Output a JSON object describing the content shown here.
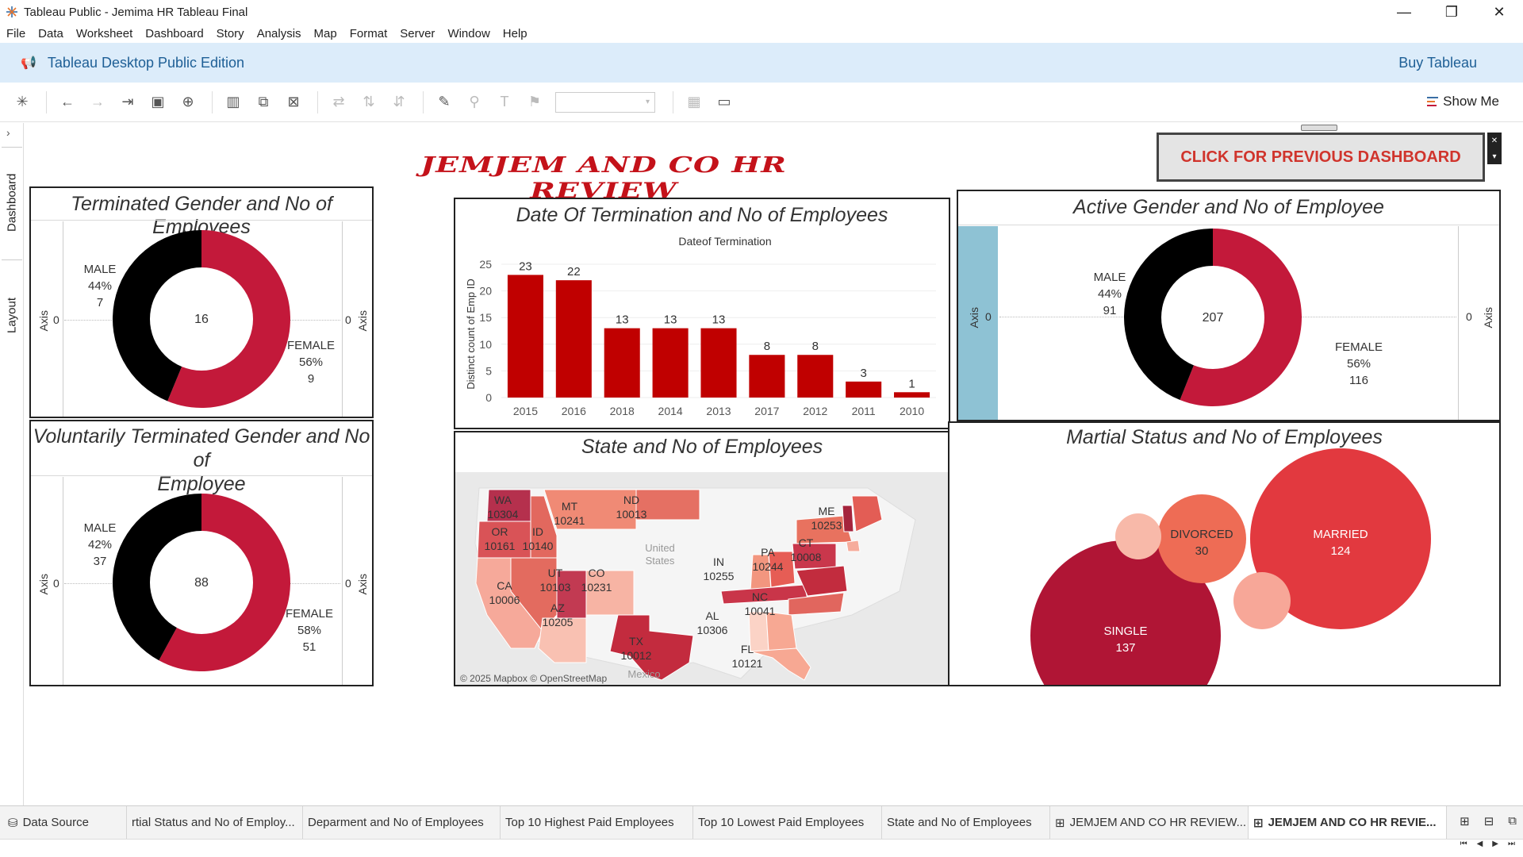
{
  "window": {
    "title": "Tableau Public - Jemima HR Tableau Final",
    "minimize": "—",
    "restore": "❐",
    "close": "✕"
  },
  "menu": [
    "File",
    "Data",
    "Worksheet",
    "Dashboard",
    "Story",
    "Analysis",
    "Map",
    "Format",
    "Server",
    "Window",
    "Help"
  ],
  "banner": {
    "edition": "Tableau Desktop Public Edition",
    "buy": "Buy Tableau"
  },
  "toolbar": {
    "icons": [
      "tableau-logo-icon",
      "undo-icon",
      "redo-icon",
      "replay-icon",
      "save-icon",
      "add-data-icon",
      "new-worksheet-icon",
      "duplicate-icon",
      "clear-sheet-icon",
      "swap-icon",
      "sort-asc-icon",
      "sort-desc-icon",
      "highlight-icon",
      "group-icon",
      "label-icon",
      "pin-icon",
      "fit-icon",
      "presentation-icon"
    ],
    "show_me": "Show Me"
  },
  "side_tabs": {
    "dashboard": "Dashboard",
    "layout": "Layout"
  },
  "dashboard": {
    "title": "JEMJEM AND CO HR REVIEW",
    "prev_button": "CLICK FOR PREVIOUS DASHBOARD"
  },
  "panels": {
    "terminated": {
      "title": "Terminated Gender and No of Employees",
      "axis": "Axis",
      "zero": "0",
      "total": "16",
      "male": {
        "label": "MALE",
        "pct": "44%",
        "count": "7",
        "value": 7
      },
      "female": {
        "label": "FEMALE",
        "pct": "56%",
        "count": "9",
        "value": 9
      }
    },
    "voluntary": {
      "title_line1": "Voluntarily Terminated Gender and No of",
      "title_line2": "Employee",
      "axis": "Axis",
      "zero": "0",
      "total": "88",
      "male": {
        "label": "MALE",
        "pct": "42%",
        "count": "37",
        "value": 37
      },
      "female": {
        "label": "FEMALE",
        "pct": "58%",
        "count": "51",
        "value": 51
      }
    },
    "active": {
      "title": "Active Gender and No of Employee",
      "axis": "Axis",
      "zero": "0",
      "total": "207",
      "male": {
        "label": "MALE",
        "pct": "44%",
        "count": "91",
        "value": 91
      },
      "female": {
        "label": "FEMALE",
        "pct": "56%",
        "count": "116",
        "value": 116
      }
    },
    "termination_date": {
      "title": "Date Of Termination and No of Employees"
    },
    "state": {
      "title": "State and No of Employees",
      "credit": "© 2025 Mapbox © OpenStreetMap",
      "region_labels": [
        "United",
        "States",
        "Mexico"
      ],
      "states": [
        {
          "code": "WA",
          "value": "10304"
        },
        {
          "code": "OR",
          "value": "10161"
        },
        {
          "code": "ID",
          "value": "10140"
        },
        {
          "code": "MT",
          "value": "10241"
        },
        {
          "code": "ND",
          "value": "10013"
        },
        {
          "code": "CA",
          "value": "10006"
        },
        {
          "code": "UT",
          "value": "10103"
        },
        {
          "code": "CO",
          "value": "10231"
        },
        {
          "code": "AZ",
          "value": "10205"
        },
        {
          "code": "TX",
          "value": "10012"
        },
        {
          "code": "IN",
          "value": "10255"
        },
        {
          "code": "PA",
          "value": "10244"
        },
        {
          "code": "CT",
          "value": "10008"
        },
        {
          "code": "ME",
          "value": "10253"
        },
        {
          "code": "NC",
          "value": "10041"
        },
        {
          "code": "AL",
          "value": "10306"
        },
        {
          "code": "FL",
          "value": "10121"
        }
      ]
    },
    "marital": {
      "title": "Martial Status and No of Employees",
      "married": {
        "label": "MARRIED",
        "count": "124"
      },
      "single": {
        "label": "SINGLE",
        "count": "137"
      },
      "divorced": {
        "label": "DIVORCED",
        "count": "30"
      }
    }
  },
  "chart_data": {
    "type": "bar",
    "title": "Dateof Termination",
    "xlabel": "",
    "ylabel": "Distinct count of Emp ID",
    "categories": [
      "2015",
      "2016",
      "2018",
      "2014",
      "2013",
      "2017",
      "2012",
      "2011",
      "2010"
    ],
    "values": [
      23,
      22,
      13,
      13,
      13,
      8,
      8,
      3,
      1
    ],
    "ylim": [
      0,
      25
    ],
    "yticks": [
      0,
      5,
      10,
      15,
      20,
      25
    ],
    "grid": true,
    "bar_color": "#c00000"
  },
  "colors": {
    "female": "#c3193a",
    "male": "#000000",
    "accent_red": "#c4121a",
    "banner_blue": "#dcecfa",
    "active_axis_fill": "#8ec2d4"
  },
  "sheet_tabs": [
    {
      "label": "Data Source",
      "icon": "data-source-icon",
      "active": false
    },
    {
      "label": "rtial Status and No of Employ...",
      "active": false
    },
    {
      "label": "Deparment and No of Employees",
      "active": false
    },
    {
      "label": "Top 10 Highest Paid Employees",
      "active": false
    },
    {
      "label": "Top 10 Lowest Paid Employees",
      "active": false
    },
    {
      "label": "State and No of Employees",
      "active": false
    },
    {
      "label": "JEMJEM AND CO HR REVIEW...",
      "icon": "dashboard-icon",
      "active": false
    },
    {
      "label": "JEMJEM AND CO HR REVIE...",
      "icon": "dashboard-icon",
      "active": true
    }
  ]
}
